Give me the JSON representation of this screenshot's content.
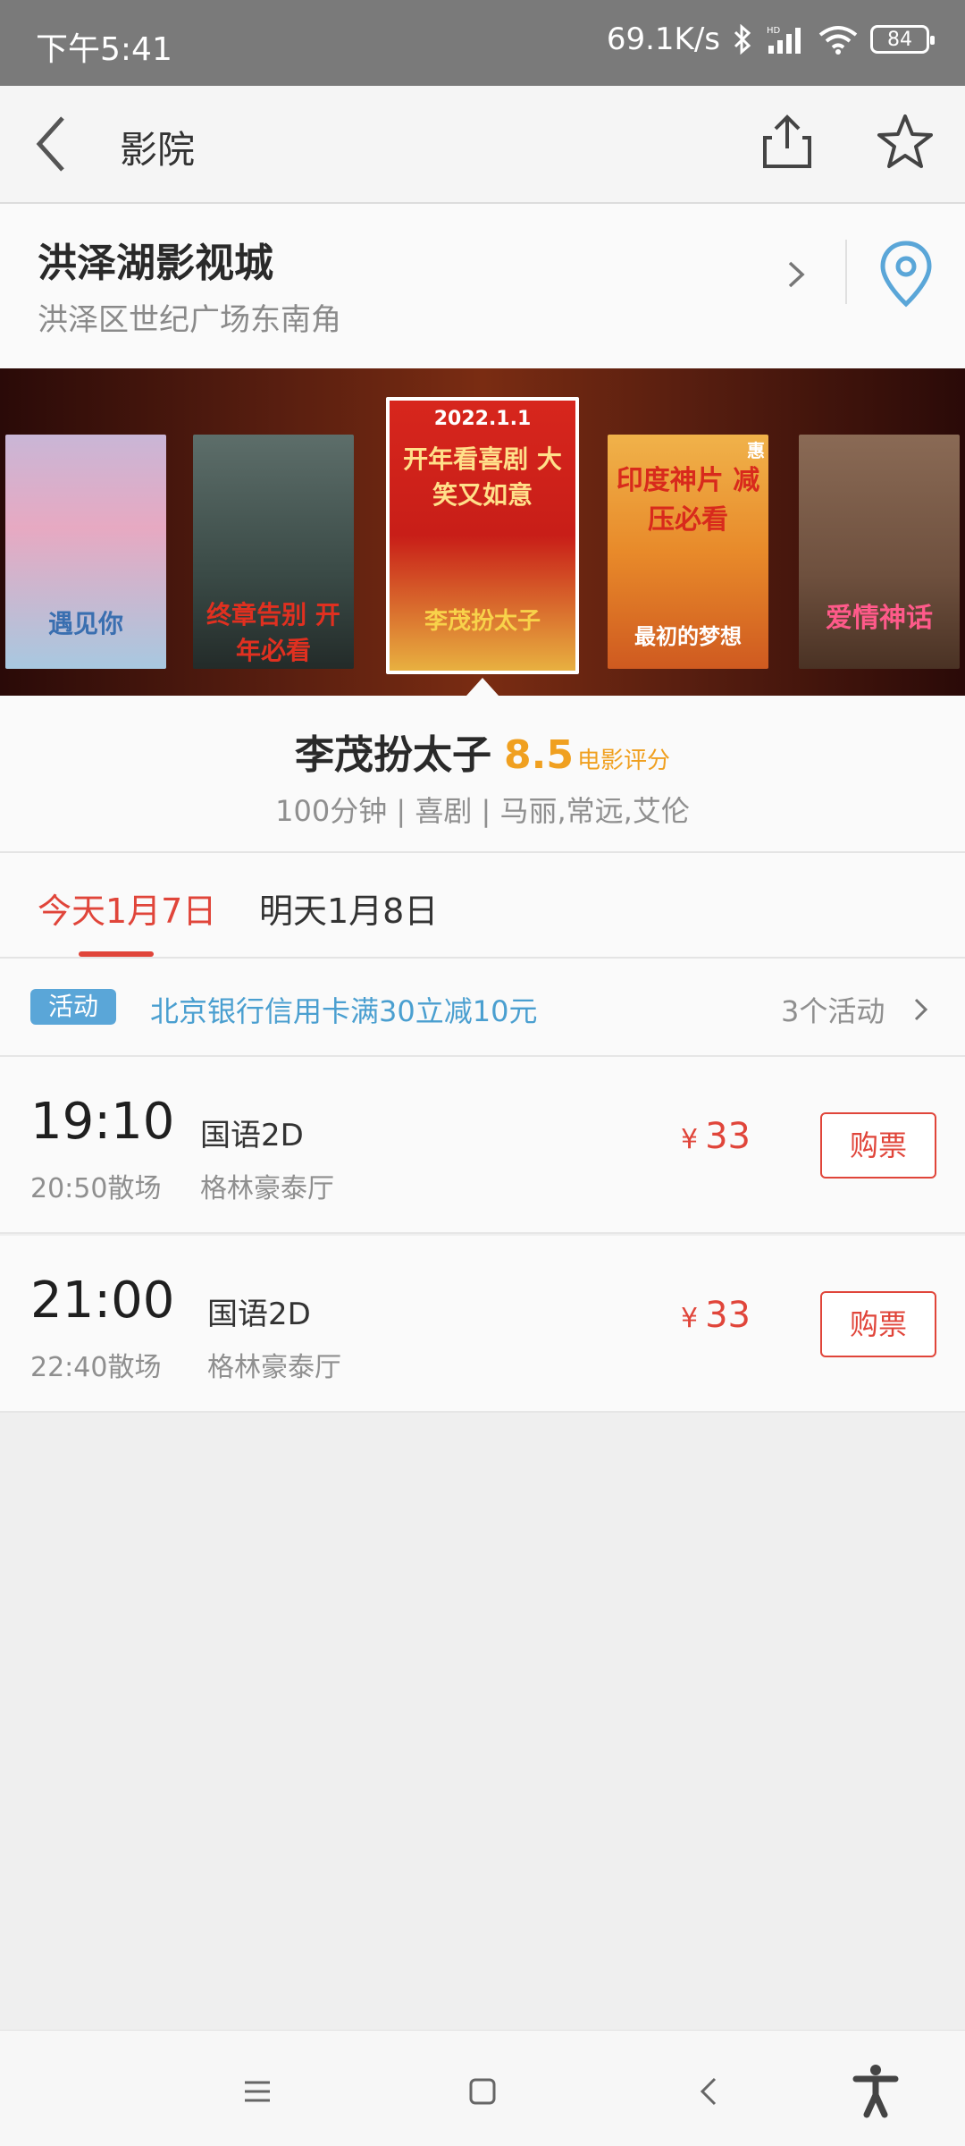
{
  "status": {
    "time": "下午5:41",
    "network": "69.1K/s",
    "hd": "HD",
    "battery": "84"
  },
  "navbar": {
    "title": "影院"
  },
  "cinema": {
    "name": "洪泽湖影视城",
    "address": "洪泽区世纪广场东南角"
  },
  "posters": [
    {
      "text": "遇见你"
    },
    {
      "text": "终章告别 开年必看"
    },
    {
      "date": "2022.1.1",
      "text": "开年看喜剧 大笑又如意",
      "subtitle": "李茂扮太子"
    },
    {
      "text": "印度神片 减压必看",
      "badge": "惠",
      "subtitle": "最初的梦想"
    },
    {
      "text": "爱情神话"
    }
  ],
  "movie": {
    "title": "李茂扮太子",
    "score": "8.5",
    "score_label": "电影评分",
    "meta": "100分钟 | 喜剧 | 马丽,常远,艾伦"
  },
  "tabs": {
    "today": "今天1月7日",
    "tomorrow": "明天1月8日"
  },
  "promo": {
    "badge": "活动",
    "text": "北京银行信用卡满30立减10元",
    "count": "3个活动"
  },
  "shows": [
    {
      "start": "19:10",
      "end": "20:50散场",
      "lang": "国语2D",
      "hall": "格林豪泰厅",
      "currency": "¥",
      "price": "33",
      "buy": "购票"
    },
    {
      "start": "21:00",
      "end": "22:40散场",
      "lang": "国语2D",
      "hall": "格林豪泰厅",
      "currency": "¥",
      "price": "33",
      "buy": "购票"
    }
  ],
  "colors": {
    "accent_red": "#e0453a",
    "score_orange": "#f0a020",
    "link_blue": "#4a9fd0",
    "badge_blue": "#5aa6d8"
  }
}
